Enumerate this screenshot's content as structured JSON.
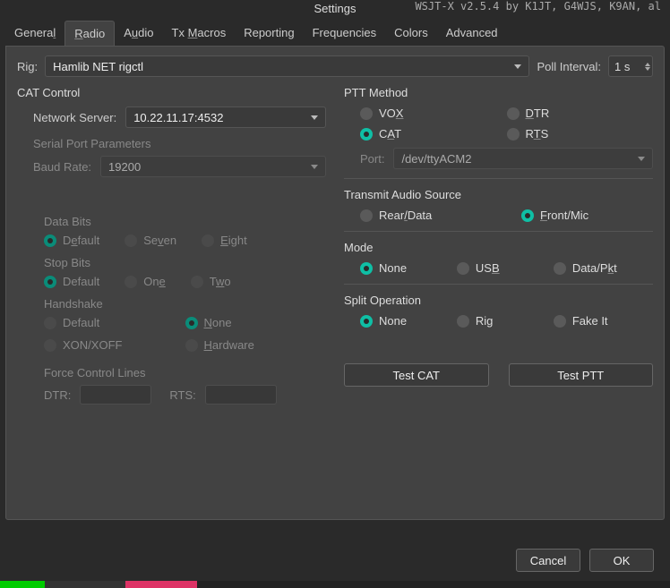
{
  "topText": "WSJT-X   v2.5.4   by K1JT, G4WJS, K9AN, al",
  "window": {
    "title": "Settings"
  },
  "tabs": [
    "General",
    "Radio",
    "Audio",
    "Tx Macros",
    "Reporting",
    "Frequencies",
    "Colors",
    "Advanced"
  ],
  "activeTab": 1,
  "rig": {
    "label": "Rig:",
    "value": "Hamlib NET rigctl",
    "pollLabel": "Poll Interval:",
    "pollValue": "1 s"
  },
  "cat": {
    "title": "CAT Control",
    "netLabel": "Network Server:",
    "netValue": "10.22.11.17:4532",
    "serialTitle": "Serial Port Parameters",
    "baudLabel": "Baud Rate:",
    "baudValue": "19200",
    "dataBits": {
      "title": "Data Bits",
      "opts": [
        "Default",
        "Seven",
        "Eight"
      ],
      "sel": 0
    },
    "stopBits": {
      "title": "Stop Bits",
      "opts": [
        "Default",
        "One",
        "Two"
      ],
      "sel": 0
    },
    "handshake": {
      "title": "Handshake",
      "opts": [
        "Default",
        "None",
        "XON/XOFF",
        "Hardware"
      ],
      "sel": 1
    },
    "force": {
      "title": "Force Control Lines",
      "dtr": "DTR:",
      "rts": "RTS:"
    }
  },
  "ptt": {
    "title": "PTT Method",
    "opts": [
      "VOX",
      "DTR",
      "CAT",
      "RTS"
    ],
    "sel": 2,
    "portLabel": "Port:",
    "portValue": "/dev/ttyACM2"
  },
  "audio": {
    "title": "Transmit Audio Source",
    "opts": [
      "Rear/Data",
      "Front/Mic"
    ],
    "sel": 1
  },
  "mode": {
    "title": "Mode",
    "opts": [
      "None",
      "USB",
      "Data/Pkt"
    ],
    "sel": 0
  },
  "split": {
    "title": "Split Operation",
    "opts": [
      "None",
      "Rig",
      "Fake It"
    ],
    "sel": 0
  },
  "buttons": {
    "testCat": "Test CAT",
    "testPtt": "Test PTT",
    "cancel": "Cancel",
    "ok": "OK"
  }
}
